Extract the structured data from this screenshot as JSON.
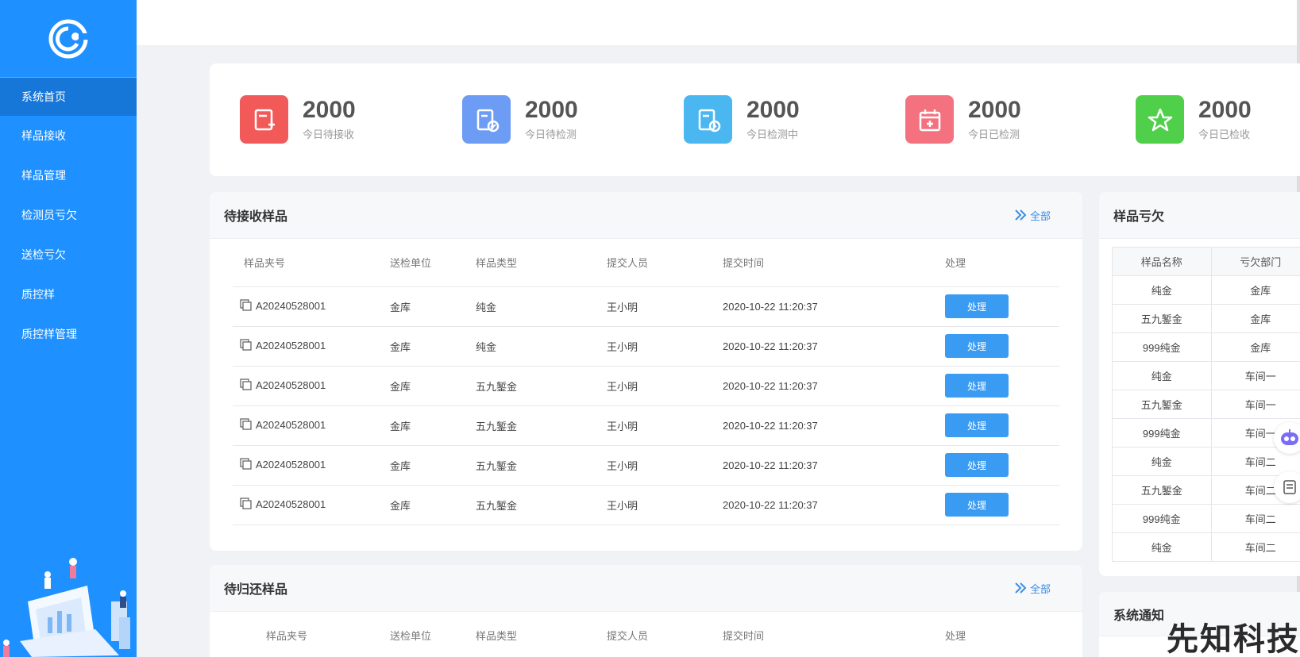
{
  "sidebar": {
    "items": [
      {
        "label": "系统首页",
        "active": true
      },
      {
        "label": "样品接收"
      },
      {
        "label": "样品管理"
      },
      {
        "label": "检测员亏欠"
      },
      {
        "label": "送检亏欠"
      },
      {
        "label": "质控样"
      },
      {
        "label": "质控样管理"
      }
    ]
  },
  "stats": [
    {
      "value": "2000",
      "label": "今日待接收",
      "color": "#f25a5a",
      "icon": "file-add-icon"
    },
    {
      "value": "2000",
      "label": "今日待检测",
      "color": "#6d9cf5",
      "icon": "file-check-icon"
    },
    {
      "value": "2000",
      "label": "今日检测中",
      "color": "#4bb7f0",
      "icon": "file-clock-icon"
    },
    {
      "value": "2000",
      "label": "今日已检测",
      "color": "#f4727f",
      "icon": "calendar-plus-icon"
    },
    {
      "value": "2000",
      "label": "今日已检收",
      "color": "#4fcf4a",
      "icon": "star-icon"
    }
  ],
  "pending_receive": {
    "title": "待接收样品",
    "more_label": "全部",
    "columns": [
      "样品夹号",
      "送检单位",
      "样品类型",
      "提交人员",
      "提交时间",
      "处理"
    ],
    "rows": [
      {
        "id": "A20240528001",
        "unit": "金库",
        "type": "纯金",
        "person": "王小明",
        "time": "2020-10-22 11:20:37",
        "action": "处理"
      },
      {
        "id": "A20240528001",
        "unit": "金库",
        "type": "纯金",
        "person": "王小明",
        "time": "2020-10-22 11:20:37",
        "action": "处理"
      },
      {
        "id": "A20240528001",
        "unit": "金库",
        "type": "五九錾金",
        "person": "王小明",
        "time": "2020-10-22 11:20:37",
        "action": "处理"
      },
      {
        "id": "A20240528001",
        "unit": "金库",
        "type": "五九錾金",
        "person": "王小明",
        "time": "2020-10-22 11:20:37",
        "action": "处理"
      },
      {
        "id": "A20240528001",
        "unit": "金库",
        "type": "五九錾金",
        "person": "王小明",
        "time": "2020-10-22 11:20:37",
        "action": "处理"
      },
      {
        "id": "A20240528001",
        "unit": "金库",
        "type": "五九錾金",
        "person": "王小明",
        "time": "2020-10-22 11:20:37",
        "action": "处理"
      }
    ]
  },
  "pending_return": {
    "title": "待归还样品",
    "more_label": "全部",
    "columns": [
      "样品夹号",
      "送检单位",
      "样品类型",
      "提交人员",
      "提交时间",
      "处理"
    ]
  },
  "shortage": {
    "title": "样品亏欠",
    "columns": [
      "样品名称",
      "亏欠部门"
    ],
    "rows": [
      [
        "纯金",
        "金库"
      ],
      [
        "五九錾金",
        "金库"
      ],
      [
        "999纯金",
        "金库"
      ],
      [
        "纯金",
        "车间一"
      ],
      [
        "五九錾金",
        "车间一"
      ],
      [
        "999纯金",
        "车间一"
      ],
      [
        "纯金",
        "车间二"
      ],
      [
        "五九錾金",
        "车间二"
      ],
      [
        "999纯金",
        "车间二"
      ],
      [
        "纯金",
        "车间二"
      ]
    ]
  },
  "notice": {
    "title": "系统通知"
  },
  "watermark": "先知科技"
}
